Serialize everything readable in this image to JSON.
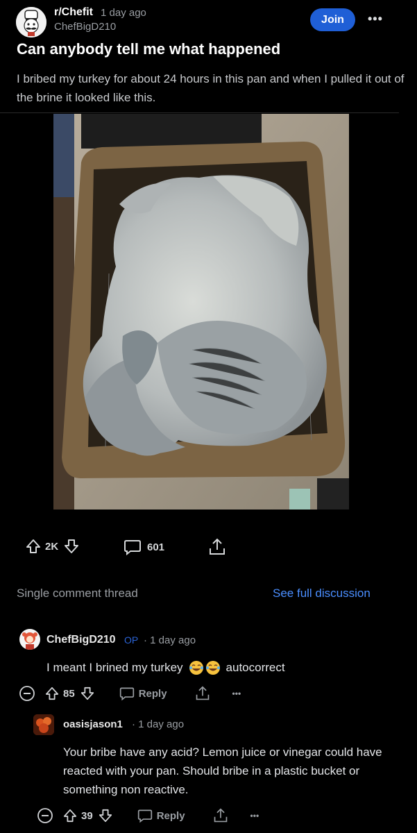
{
  "header": {
    "subreddit": "r/Chefit",
    "time": "1 day ago",
    "author": "ChefBigD210",
    "join_label": "Join",
    "more_label": "•••"
  },
  "post": {
    "title": "Can anybody tell me what happened",
    "body": "I bribed my turkey for about 24 hours in this pan and when I pulled it out of the brine it looked like this.",
    "image_icon": "turkey-photo",
    "votes": "2K",
    "comments": "601"
  },
  "thread": {
    "label": "Single comment thread",
    "full_link": "See full discussion"
  },
  "comments": [
    {
      "author": "ChefBigD210",
      "op_tag": "OP",
      "time": "1 day ago",
      "text_before": "I meant I brined my turkey",
      "text_after": "autocorrect",
      "emoji": "laughing-tears-emoji",
      "votes": "85",
      "reply_label": "Reply",
      "more_label": "•••"
    },
    {
      "author": "oasisjason1",
      "time": "1 day ago",
      "text": "Your bribe have any acid? Lemon juice or vinegar could have reacted with your pan. Should bribe in a plastic bucket or something non reactive.",
      "votes": "39",
      "reply_label": "Reply",
      "more_label": "•••"
    }
  ],
  "colors": {
    "accent": "#1f5fd6",
    "link": "#4a8eff",
    "op_tag": "#2b64d8"
  }
}
